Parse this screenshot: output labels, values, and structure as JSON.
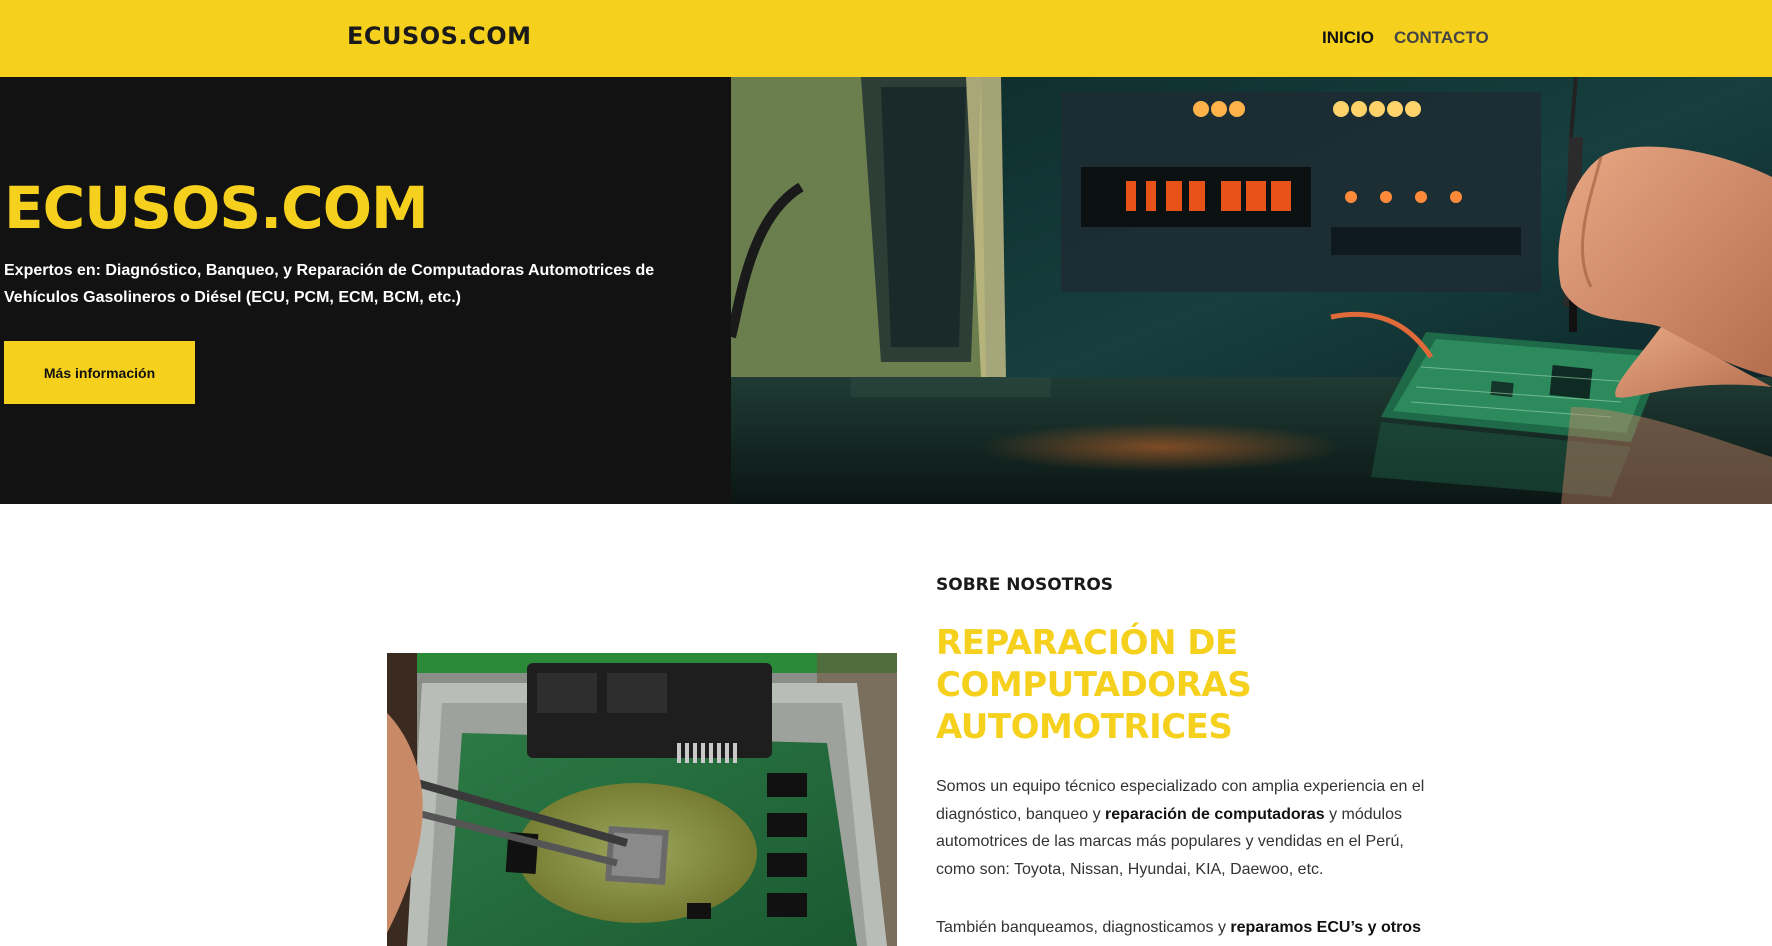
{
  "header": {
    "logo": "ECUSOS.COM",
    "nav": [
      {
        "label": "INICIO",
        "active": true
      },
      {
        "label": "CONTACTO",
        "active": false
      }
    ]
  },
  "hero": {
    "title": "ECUSOS.COM",
    "subtitle": "Expertos en: Diagnóstico, Banqueo, y Reparación de Computadoras Automotrices de Vehículos Gasolineros o Diésel (ECU, PCM, ECM, BCM, etc.)",
    "button_label": "Más información",
    "image_display": {
      "left": "1177.288.",
      "right": "1177.288."
    }
  },
  "about": {
    "kicker": "SOBRE NOSOTROS",
    "title": "REPARACIÓN DE COMPUTADORAS AUTOMOTRICES",
    "paragraph1": {
      "before": "Somos un equipo técnico especializado con amplia experiencia en el diagnóstico, banqueo y ",
      "bold": "reparación de computadoras",
      "after": " y módulos automotrices de las marcas más populares y vendidas en el Perú, como son: Toyota, Nissan, Hyundai, KIA, Daewoo, etc."
    },
    "paragraph2": {
      "before": "También banqueamos, diagnosticamos y ",
      "bold": "reparamos ECU’s y otros"
    }
  },
  "colors": {
    "accent": "#f5d01c",
    "dark": "#121212"
  }
}
